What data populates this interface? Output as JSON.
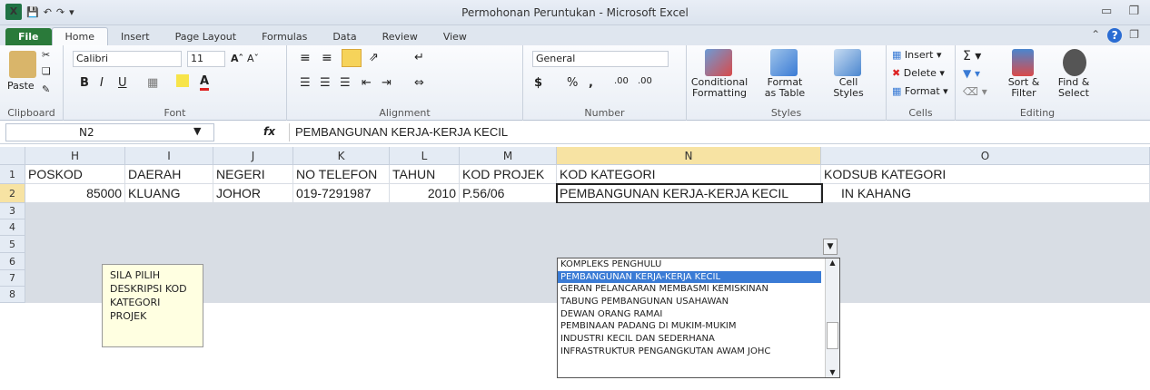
{
  "window": {
    "title": "Permohonan Peruntukan - Microsoft Excel"
  },
  "ribbon_tabs": [
    "File",
    "Home",
    "Insert",
    "Page Layout",
    "Formulas",
    "Data",
    "Review",
    "View"
  ],
  "active_tab": "Home",
  "ribbon": {
    "clipboard": {
      "paste": "Paste",
      "label": "Clipboard"
    },
    "font": {
      "name": "Calibri",
      "size": "11",
      "bold": "B",
      "italic": "I",
      "underline": "U",
      "label": "Font"
    },
    "alignment": {
      "label": "Alignment"
    },
    "number": {
      "format": "General",
      "currency": "$",
      "percent": "%",
      "comma": ",",
      "inc": ".00",
      "dec": ".00",
      "label": "Number"
    },
    "styles": {
      "conditional": "Conditional",
      "conditional2": "Formatting",
      "format_table": "Format",
      "format_table2": "as Table",
      "cell": "Cell",
      "cell2": "Styles",
      "label": "Styles"
    },
    "cells": {
      "insert": "Insert",
      "delete": "Delete",
      "format": "Format",
      "label": "Cells"
    },
    "editing": {
      "sort": "Sort &",
      "sort2": "Filter",
      "find": "Find &",
      "find2": "Select",
      "label": "Editing"
    }
  },
  "formula_bar": {
    "name_box": "N2",
    "fx": "fx",
    "value": "PEMBANGUNAN KERJA-KERJA KECIL"
  },
  "columns": [
    "H",
    "I",
    "J",
    "K",
    "L",
    "M",
    "N",
    "O"
  ],
  "rows": [
    "1",
    "2",
    "3",
    "4",
    "5",
    "6",
    "7",
    "8"
  ],
  "header_row": [
    "POSKOD",
    "DAERAH",
    "NEGERI",
    "NO TELEFON",
    "TAHUN",
    "KOD PROJEK",
    "KOD KATEGORI",
    "KODSUB KATEGORI"
  ],
  "data_row": [
    "85000",
    "KLUANG",
    "JOHOR",
    "019-7291987",
    "2010",
    "P.56/06",
    "PEMBANGUNAN KERJA-KERJA KECIL",
    "IN KAHANG"
  ],
  "comment": "SILA PILIH DESKRIPSI KOD KATEGORI PROJEK",
  "dropdown": {
    "items": [
      "KOMPLEKS PENGHULU",
      "PEMBANGUNAN KERJA-KERJA KECIL",
      "GERAN PELANCARAN MEMBASMI KEMISKINAN",
      "TABUNG PEMBANGUNAN USAHAWAN",
      "DEWAN ORANG RAMAI",
      "PEMBINAAN PADANG DI MUKIM-MUKIM",
      "INDUSTRI KECIL DAN SEDERHANA",
      "INFRASTRUKTUR PENGANGKUTAN AWAM JOHC"
    ],
    "selected_index": 1
  }
}
